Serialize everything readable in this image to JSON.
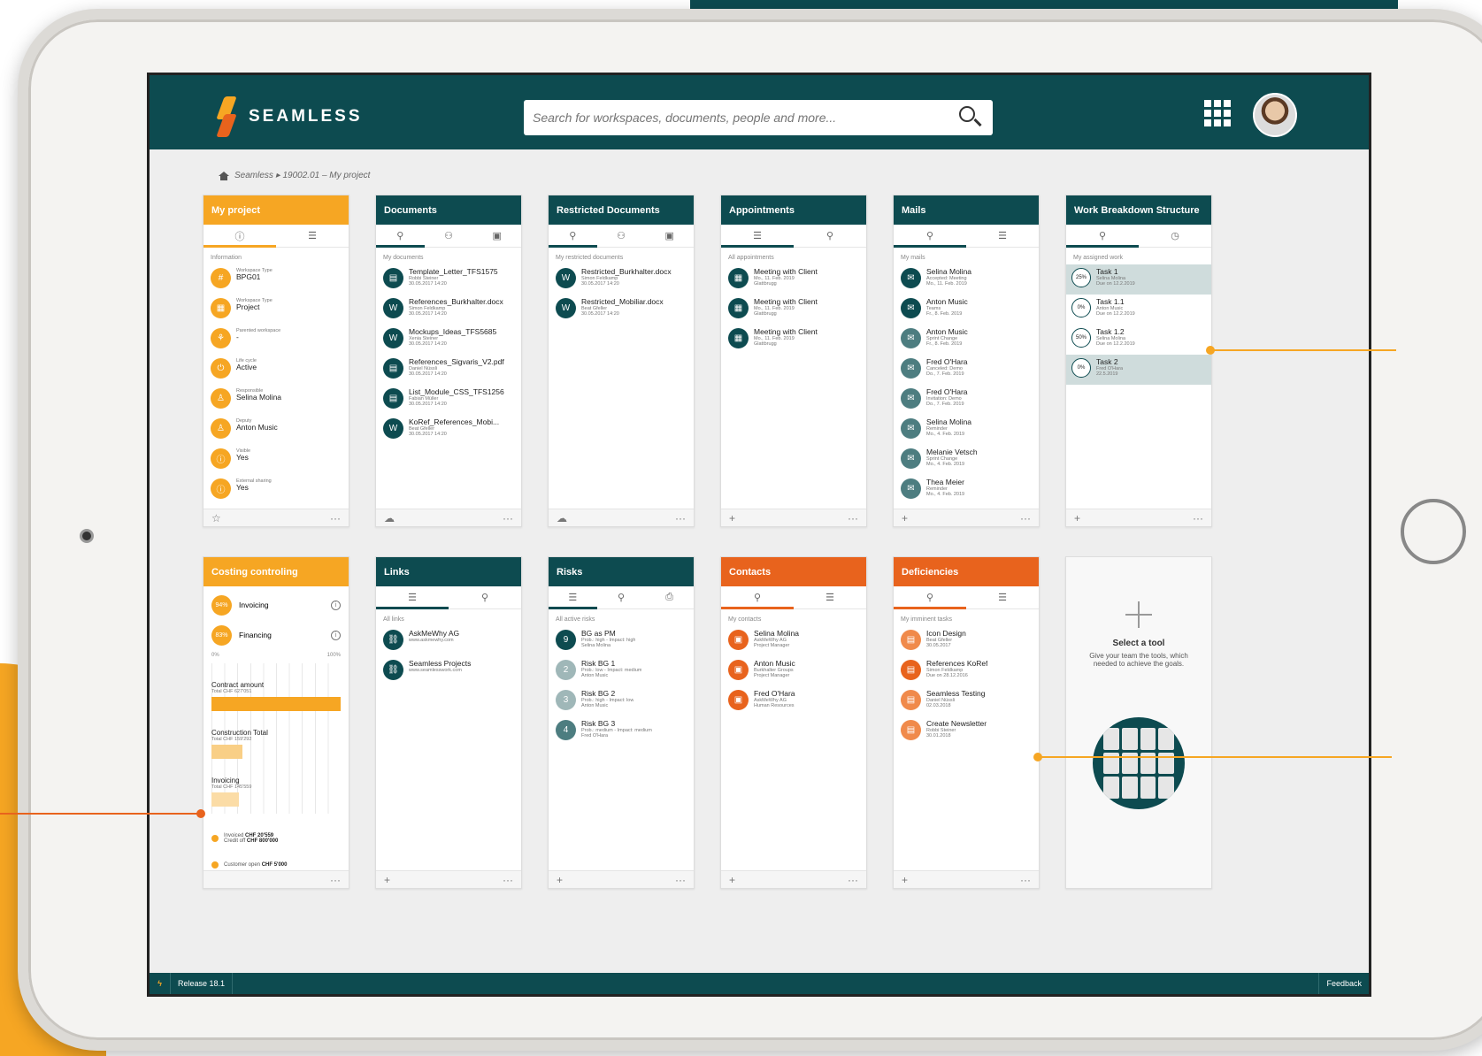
{
  "topbar": {
    "logo_text": "SEAMLESS",
    "search_placeholder": "Search for workspaces, documents, people and more..."
  },
  "breadcrumb": "Seamless ▸ 19002.01 – My project",
  "project": {
    "title": "My project",
    "section": "Information",
    "items": [
      {
        "label": "Workspace Type",
        "value": "BPG01",
        "icon": "hash-icon"
      },
      {
        "label": "Workspace Type",
        "value": "Project",
        "icon": "grid-icon"
      },
      {
        "label": "Parented workspace",
        "value": "-",
        "icon": "hierarchy-icon"
      },
      {
        "label": "Life cycle",
        "value": "Active",
        "icon": "power-icon"
      },
      {
        "label": "Responsible",
        "value": "Selina Molina",
        "icon": "person-icon"
      },
      {
        "label": "Deputy",
        "value": "Anton Music",
        "icon": "person-icon"
      },
      {
        "label": "Visible",
        "value": "Yes",
        "icon": "info-icon"
      },
      {
        "label": "External sharing",
        "value": "Yes",
        "icon": "info-icon"
      }
    ]
  },
  "documents": {
    "title": "Documents",
    "section": "My documents",
    "items": [
      {
        "name": "Template_Letter_TFS1575",
        "by": "Robbi Steiner",
        "date": "30.05.2017 14:20",
        "icon": "doc-icon"
      },
      {
        "name": "References_Burkhalter.docx",
        "by": "Simon Feldkamp",
        "date": "30.05.2017 14:20",
        "icon": "word-icon"
      },
      {
        "name": "Mockups_Ideas_TFS5685",
        "by": "Xenia Steiner",
        "date": "30.05.2017 14:20",
        "icon": "word-icon"
      },
      {
        "name": "References_Sigvaris_V2.pdf",
        "by": "Daniel Nüssli",
        "date": "30.05.2017 14:20",
        "icon": "doc-icon"
      },
      {
        "name": "List_Module_CSS_TFS1256",
        "by": "Fabian Müller",
        "date": "30.05.2017 14:20",
        "icon": "doc-icon"
      },
      {
        "name": "KoRef_References_Mobi...",
        "by": "Beat Gfeller",
        "date": "30.05.2017 14:20",
        "icon": "word-icon"
      }
    ]
  },
  "restricted": {
    "title": "Restricted Documents",
    "section": "My restricted documents",
    "items": [
      {
        "name": "Restricted_Burkhalter.docx",
        "by": "Simon Feldkamp",
        "date": "30.05.2017 14:20"
      },
      {
        "name": "Restricted_Mobiliar.docx",
        "by": "Beat Gfeller",
        "date": "30.05.2017 14:20"
      }
    ]
  },
  "appointments": {
    "title": "Appointments",
    "section": "All appointments",
    "items": [
      {
        "name": "Meeting with Client",
        "date": "Mo., 11. Feb. 2019",
        "place": "Glattbrugg"
      },
      {
        "name": "Meeting with Client",
        "date": "Mo., 11. Feb. 2019",
        "place": "Glattbrugg"
      },
      {
        "name": "Meeting with Client",
        "date": "Mo., 11. Feb. 2019",
        "place": "Glattbrugg"
      }
    ]
  },
  "mails": {
    "title": "Mails",
    "section": "My mails",
    "items": [
      {
        "name": "Selina Molina",
        "sub": "Accepted: Meeting",
        "date": "Mo., 11. Feb. 2019",
        "read": false
      },
      {
        "name": "Anton Music",
        "sub": "Teams",
        "date": "Fr., 8. Feb. 2019",
        "read": false
      },
      {
        "name": "Anton Music",
        "sub": "Sprint Change",
        "date": "Fr., 8. Feb. 2019",
        "read": true
      },
      {
        "name": "Fred O'Hara",
        "sub": "Canceled: Demo",
        "date": "Do., 7. Feb. 2019",
        "read": true
      },
      {
        "name": "Fred O'Hara",
        "sub": "Invitation: Demo",
        "date": "Do., 7. Feb. 2019",
        "read": true
      },
      {
        "name": "Selina Molina",
        "sub": "Reminder",
        "date": "Mo., 4. Feb. 2019",
        "read": true
      },
      {
        "name": "Melanie Vetsch",
        "sub": "Sprint Change",
        "date": "Mo., 4. Feb. 2019",
        "read": true
      },
      {
        "name": "Thea Meier",
        "sub": "Reminder",
        "date": "Mo., 4. Feb. 2019",
        "read": true
      }
    ]
  },
  "wbs": {
    "title": "Work Breakdown Structure",
    "section": "My assigned work",
    "items": [
      {
        "pct": "25%",
        "name": "Task 1",
        "by": "Selina Molina",
        "due": "Due on 12.2.2019",
        "highlight": true
      },
      {
        "pct": "0%",
        "name": "Task 1.1",
        "by": "Anton Music",
        "due": "Due on 12.2.2019",
        "highlight": false
      },
      {
        "pct": "50%",
        "name": "Task 1.2",
        "by": "Selina Molina",
        "due": "Due on 12.2.2019",
        "highlight": false
      },
      {
        "pct": "0%",
        "name": "Task 2",
        "by": "Fred O'Hara",
        "due": "22.5.2019",
        "highlight": true
      }
    ]
  },
  "costing": {
    "title": "Costing controling",
    "rows": [
      {
        "pct": "94%",
        "label": "Invoicing"
      },
      {
        "pct": "83%",
        "label": "Financing"
      }
    ],
    "axis_min": "0%",
    "axis_max": "100%",
    "bars": [
      {
        "label": "Contract amount",
        "sub": "Total CHF 627'051",
        "fraction": 1.0,
        "color": "#f6a623"
      },
      {
        "label": "Construction Total",
        "sub": "Total CHF 159'292",
        "fraction": 0.24,
        "color": "#f9cf86"
      },
      {
        "label": "Invoicing",
        "sub": "Total CHF 145'559",
        "fraction": 0.21,
        "color": "#fbdca6"
      }
    ],
    "legend": [
      {
        "a": "Invoiced",
        "av": "CHF 20'559",
        "b": "Credit off",
        "bv": "CHF 800'000"
      },
      {
        "a": "Customer open",
        "av": "CHF 5'000"
      }
    ]
  },
  "links": {
    "title": "Links",
    "section": "All links",
    "items": [
      {
        "name": "AskMeWhy AG",
        "url": "www.askmewhy.com"
      },
      {
        "name": "Seamless Projects",
        "url": "www.seamlesswork.com"
      }
    ]
  },
  "risks": {
    "title": "Risks",
    "section": "All active risks",
    "items": [
      {
        "num": "9",
        "name": "BG as PM",
        "prob": "Prob.: high - Impact: high",
        "by": "Selina Molina",
        "tone": "teal"
      },
      {
        "num": "2",
        "name": "Risk BG 1",
        "prob": "Prob.: low - Impact: medium",
        "by": "Anton Music",
        "tone": "gray"
      },
      {
        "num": "3",
        "name": "Risk BG 2",
        "prob": "Prob.: high - Impact: low",
        "by": "Anton Music",
        "tone": "gray"
      },
      {
        "num": "4",
        "name": "Risk BG 3",
        "prob": "Prob.: medium - Impact: medium",
        "by": "Fred O'Hara",
        "tone": "teal2"
      }
    ]
  },
  "contacts": {
    "title": "Contacts",
    "section": "My contacts",
    "items": [
      {
        "name": "Selina Molina",
        "org": "AskMeWhy AG",
        "role": "Project Manager"
      },
      {
        "name": "Anton Music",
        "org": "Burkhalter Groups",
        "role": "Project Manager"
      },
      {
        "name": "Fred O'Hara",
        "org": "AskMeWhy AG",
        "role": "Human Resources"
      }
    ]
  },
  "deficiencies": {
    "title": "Deficiencies",
    "section": "My imminent tasks",
    "items": [
      {
        "name": "Icon Design",
        "by": "Beat Gfeller",
        "date": "30.05.2017"
      },
      {
        "name": "References KoRef",
        "by": "Simon Feldkamp",
        "date": "Due on 28.12.2016"
      },
      {
        "name": "Seamless Testing",
        "by": "Daniel Nüssli",
        "date": "02.03.2018"
      },
      {
        "name": "Create Newsletter",
        "by": "Robbi Steiner",
        "date": "30.01.2018"
      }
    ]
  },
  "tool": {
    "title": "Select a tool",
    "desc": "Give your team the tools, which needed to achieve the goals."
  },
  "statusbar": {
    "release": "Release 18.1",
    "feedback": "Feedback"
  }
}
